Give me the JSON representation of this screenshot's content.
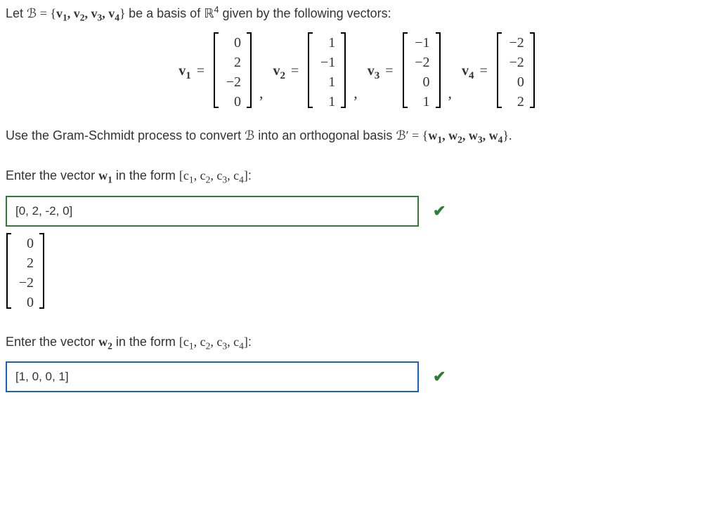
{
  "intro_prefix": "Let ",
  "basis_sym": "B",
  "basis_eq": " = {",
  "basis_vecs": "v₁, v₂, v₃, v₄",
  "basis_close": "}",
  "intro_mid": " be a basis of ",
  "space": "ℝ",
  "space_sup": "4",
  "intro_suffix": " given by the following vectors:",
  "vectors": {
    "v1": {
      "label": "v",
      "sub": "1",
      "vals": [
        "0",
        "2",
        "−2",
        "0"
      ]
    },
    "v2": {
      "label": "v",
      "sub": "2",
      "vals": [
        "1",
        "−1",
        "1",
        "1"
      ]
    },
    "v3": {
      "label": "v",
      "sub": "3",
      "vals": [
        "−1",
        "−2",
        "0",
        "1"
      ]
    },
    "v4": {
      "label": "v",
      "sub": "4",
      "vals": [
        "−2",
        "−2",
        "0",
        "2"
      ]
    }
  },
  "gs_prefix": "Use the Gram-Schmidt process to convert ",
  "gs_b": "B",
  "gs_mid": " into an orthogonal basis ",
  "gs_bprime": "B′",
  "gs_eq": " = {",
  "gs_ws": "w₁, w₂, w₃, w₄",
  "gs_close": "}.",
  "prompts": {
    "w1": {
      "pre": "Enter the vector ",
      "sym": "w",
      "sub": "1",
      "mid": " in the form ",
      "form": "[c₁, c₂, c₃, c₄]",
      "colon": ":"
    },
    "w2": {
      "pre": "Enter the vector ",
      "sym": "w",
      "sub": "2",
      "mid": " in the form ",
      "form": "[c₁, c₂, c₃, c₄]",
      "colon": ":"
    }
  },
  "answers": {
    "w1": {
      "value": "[0, 2, -2, 0]",
      "result_vals": [
        "0",
        "2",
        "−2",
        "0"
      ]
    },
    "w2": {
      "value": "[1, 0, 0, 1]"
    }
  },
  "checkmark": "✔"
}
